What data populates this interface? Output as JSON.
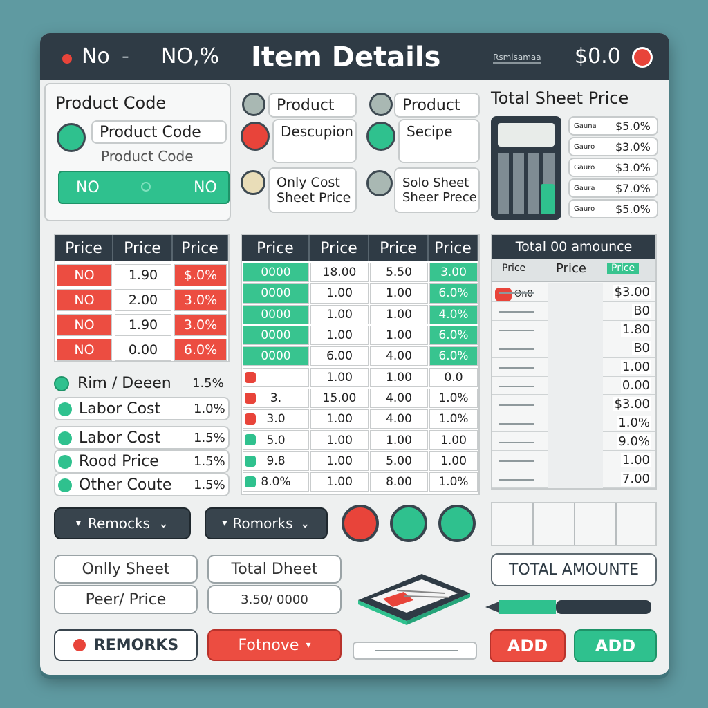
{
  "titlebar": {
    "left_no": "No",
    "left_dash": "-",
    "left_value": "NO,%",
    "title": "Item Details",
    "right_label": "Rsmisamaa",
    "right_value": "$0.0"
  },
  "product": {
    "code_label": "Product Code",
    "code_value": "Product Code",
    "code_sub": "Product Code",
    "no_left": "NO",
    "no_right": "NO"
  },
  "col2": {
    "f1": "Product",
    "f2": "Descupion",
    "f3a": "Only Cost",
    "f3b": "Sheet Price"
  },
  "col3": {
    "f1": "Product",
    "f2": "Secipe",
    "f3a": "Solo Sheet",
    "f3b": "Sheer Prece"
  },
  "total_sheet": {
    "title": "Total Sheet Price",
    "rows": [
      {
        "label": "Gauna",
        "value": "$5.0%"
      },
      {
        "label": "Gauro",
        "value": "$3.0%"
      },
      {
        "label": "Gauro",
        "value": "$3.0%"
      },
      {
        "label": "Gaura",
        "value": "$7.0%"
      },
      {
        "label": "Gauro",
        "value": "$5.0%"
      }
    ]
  },
  "table1": {
    "headers": [
      "Price",
      "Price",
      "Price"
    ],
    "rows": [
      [
        "NO",
        "1.90",
        "$.0%"
      ],
      [
        "NO",
        "2.00",
        "3.0%"
      ],
      [
        "NO",
        "1.90",
        "3.0%"
      ],
      [
        "NO",
        "0.00",
        "6.0%"
      ]
    ]
  },
  "table2": {
    "headers": [
      "Price",
      "Price",
      "Price",
      "Price"
    ],
    "rows": [
      [
        "0000",
        "18.00",
        "5.50",
        "3.00"
      ],
      [
        "0000",
        "1.00",
        "1.00",
        "6.0%"
      ],
      [
        "0000",
        "1.00",
        "1.00",
        "4.0%"
      ],
      [
        "0000",
        "1.00",
        "1.00",
        "6.0%"
      ],
      [
        "0000",
        "6.00",
        "4.00",
        "6.0%"
      ],
      [
        "",
        "1.00",
        "1.00",
        "0.0"
      ],
      [
        "3.",
        "15.00",
        "4.00",
        "1.0%"
      ],
      [
        "3.0",
        "1.00",
        "4.00",
        "1.0%"
      ],
      [
        "5.0",
        "1.00",
        "1.00",
        "1.00"
      ],
      [
        "9.8",
        "1.00",
        "5.00",
        "1.00"
      ],
      [
        "8.0%",
        "1.00",
        "8.00",
        "1.0%"
      ]
    ]
  },
  "costs": [
    {
      "label": "Rim / Deeen",
      "value": "1.5%"
    },
    {
      "label": "Labor Cost",
      "value": "1.0%"
    },
    {
      "label": "Labor Cost",
      "value": "1.5%"
    },
    {
      "label": "Rood Price",
      "value": "1.5%"
    },
    {
      "label": "Other Coute",
      "value": "1.5%"
    }
  ],
  "total_amount_table": {
    "title": "Total 00 amounce",
    "headers": [
      "Price",
      "Price",
      "Price"
    ],
    "row1_label": "On0",
    "values": [
      "$3.00",
      "B0",
      "1.80",
      "B0",
      "1.00",
      "0.00",
      "$3.00",
      "1.0%",
      "9.0%",
      "1.00",
      "7.00"
    ]
  },
  "buttons": {
    "remarks1": "Remocks",
    "remarks2": "Romorks",
    "only_sheet": "Onlly Sheet",
    "peer_price": "Peer/ Price",
    "total_sheet": "Total Dheet",
    "total_sheet2": "3.50/ 0000",
    "total_amount": "TOTAL AMOUNTE",
    "remarks_upper": "REMORKS",
    "fotnove": "Fotnove",
    "add_red": "ADD",
    "add_green": "ADD"
  },
  "colors": {
    "accent_green": "#2fc18e",
    "accent_red": "#e8443a",
    "dark": "#2f3b45"
  }
}
